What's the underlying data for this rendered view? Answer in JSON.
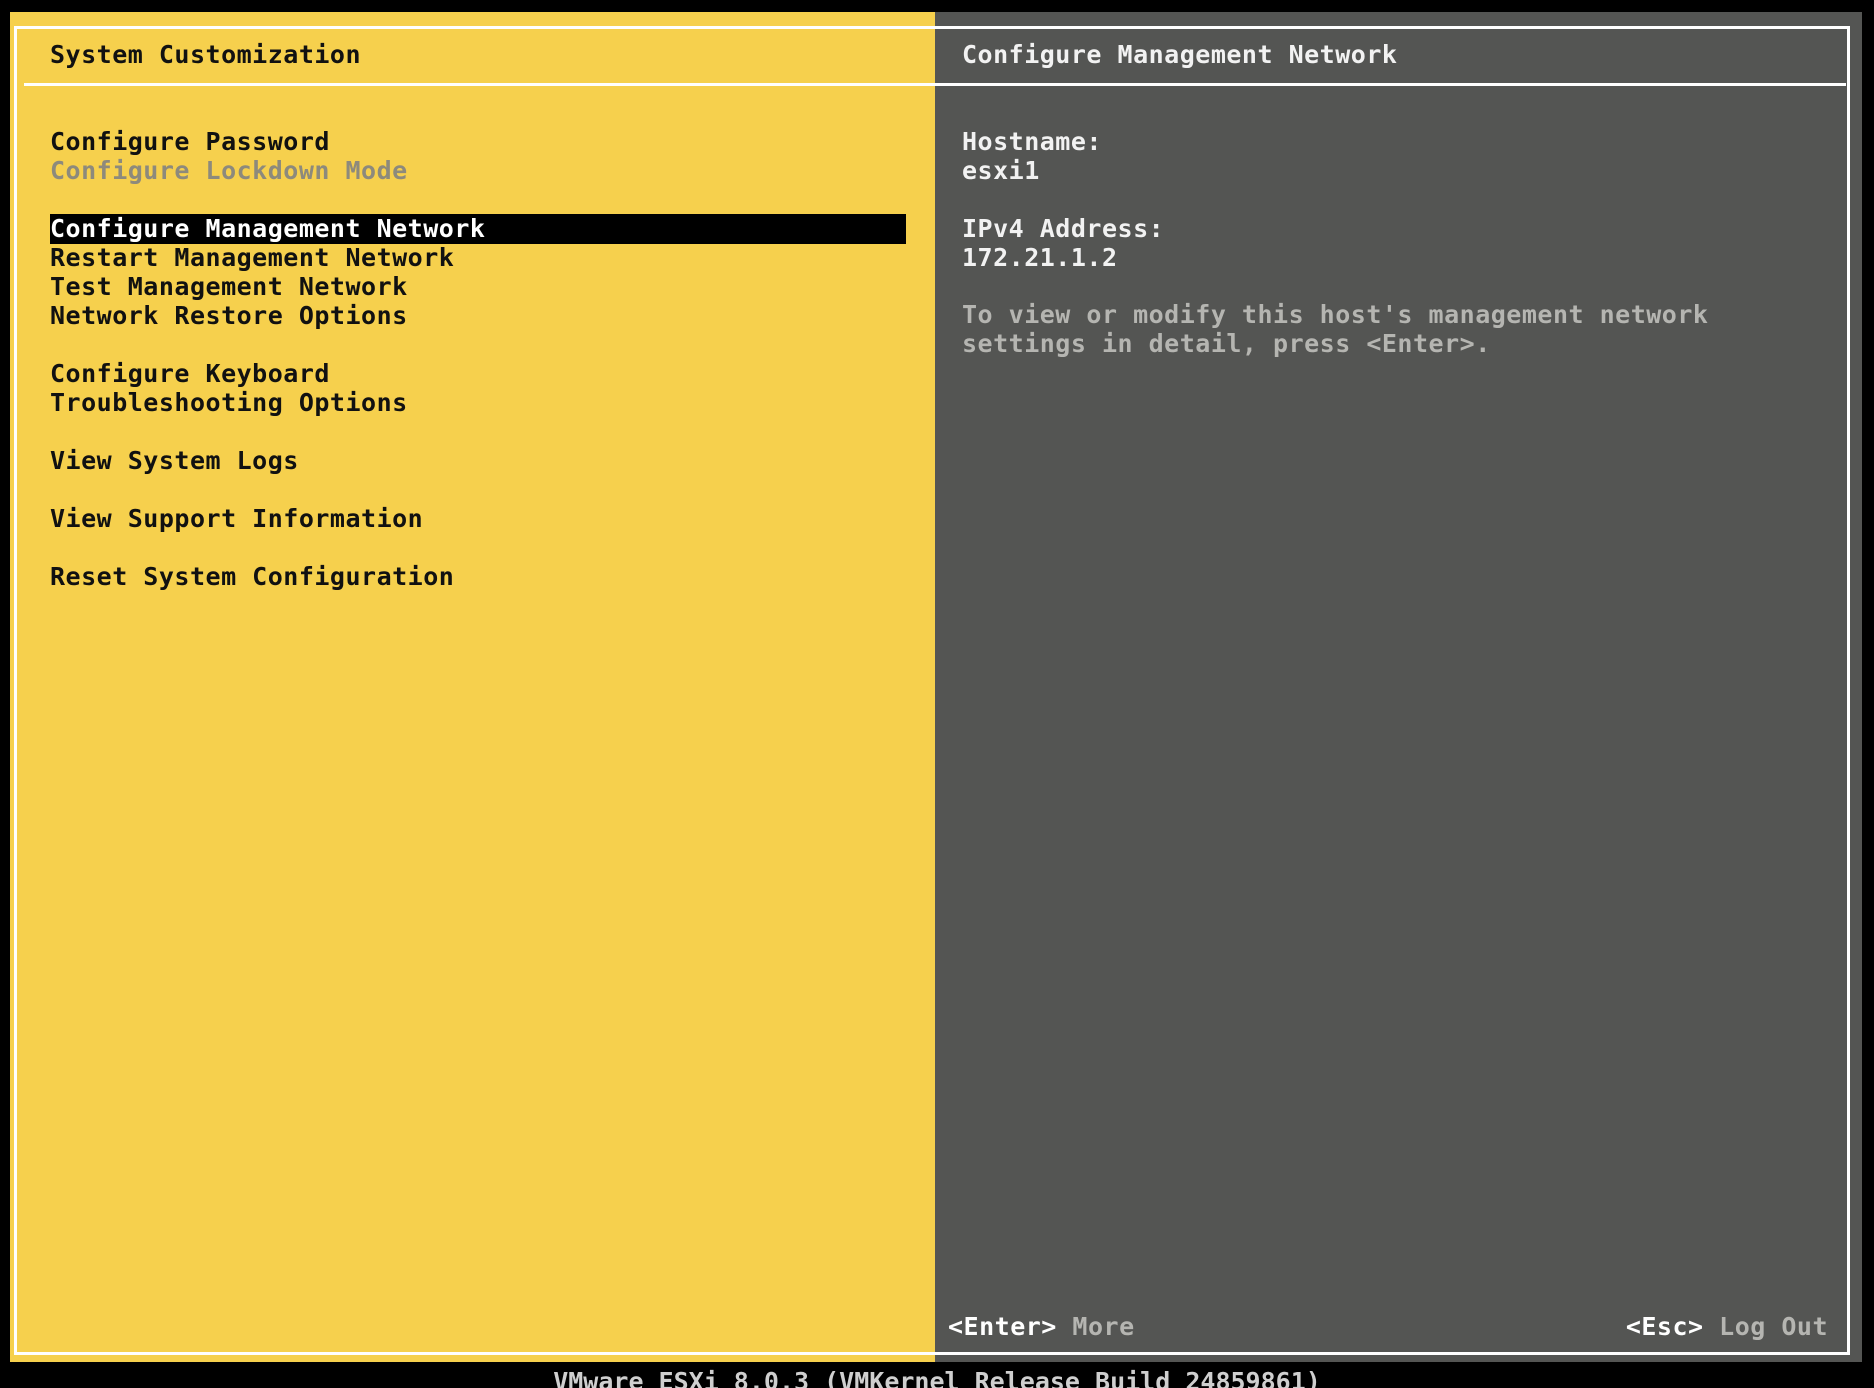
{
  "left_panel": {
    "title": "System Customization",
    "menu": [
      {
        "label": "Configure Password",
        "state": "normal"
      },
      {
        "label": "Configure Lockdown Mode",
        "state": "disabled"
      },
      {
        "label": "Configure Management Network",
        "state": "selected"
      },
      {
        "label": "Restart Management Network",
        "state": "normal"
      },
      {
        "label": "Test Management Network",
        "state": "normal"
      },
      {
        "label": "Network Restore Options",
        "state": "normal"
      },
      {
        "label": "Configure Keyboard",
        "state": "normal"
      },
      {
        "label": "Troubleshooting Options",
        "state": "normal"
      },
      {
        "label": "View System Logs",
        "state": "normal"
      },
      {
        "label": "View Support Information",
        "state": "normal"
      },
      {
        "label": "Reset System Configuration",
        "state": "normal"
      }
    ]
  },
  "right_panel": {
    "title": "Configure Management Network",
    "hostname_label": "Hostname:",
    "hostname_value": "esxi1",
    "ipv4_label": "IPv4 Address:",
    "ipv4_value": "172.21.1.2",
    "description": "To view or modify this host's management network settings in detail, press <Enter>."
  },
  "footer": {
    "enter_key": "<Enter>",
    "enter_action": "More",
    "esc_key": "<Esc>",
    "esc_action": "Log Out"
  },
  "status_bar": "VMware ESXi 8.0.3 (VMKernel Release Build 24859861)",
  "colors": {
    "left_background": "#f6d04d",
    "right_background": "#545553",
    "selection_background": "#000000",
    "frame": "#ffffff"
  }
}
